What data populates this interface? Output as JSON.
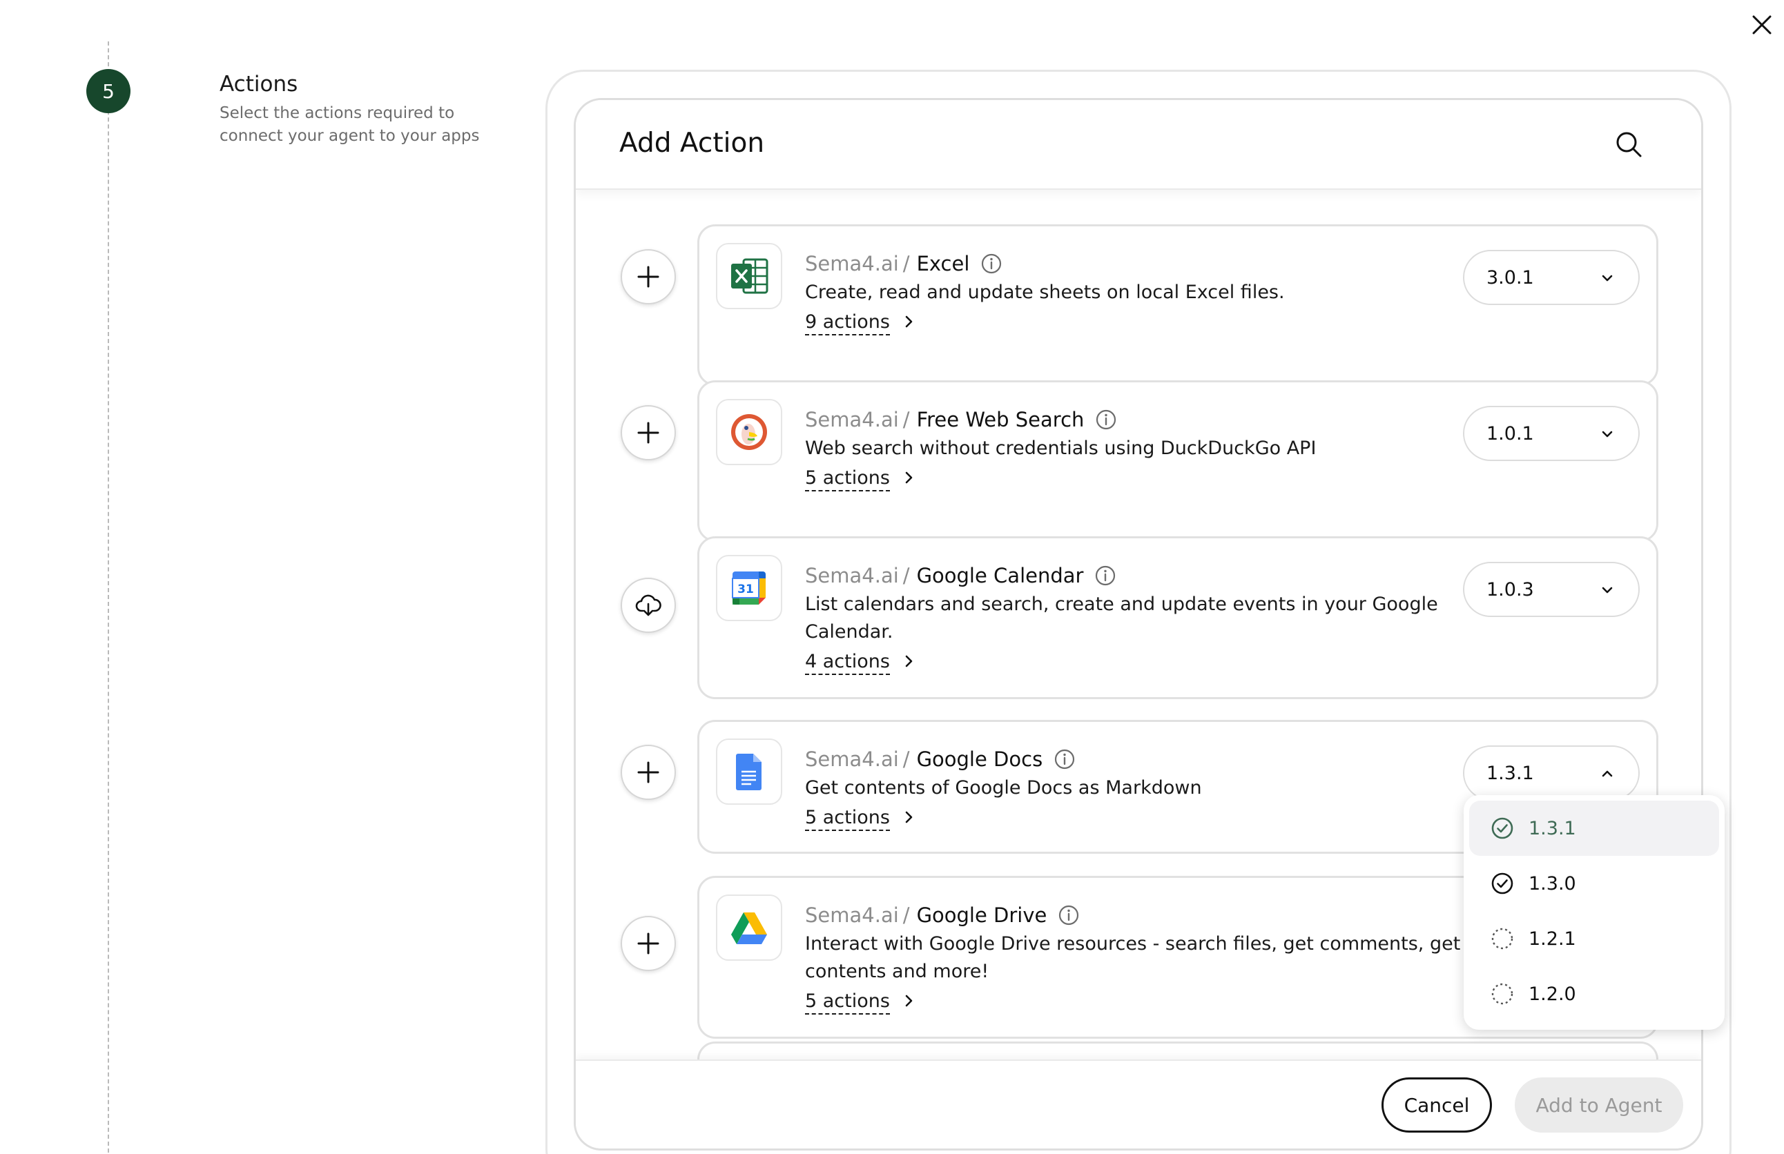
{
  "step": {
    "number": "5",
    "title": "Actions",
    "subtitle": "Select the actions required to connect your agent to your apps"
  },
  "panel": {
    "title": "Add Action"
  },
  "items": [
    {
      "vendor": "Sema4.ai",
      "name": "Excel",
      "description": "Create, read and update sheets on local Excel files.",
      "actions_label": "9 actions",
      "version": "3.0.1",
      "button_state": "add",
      "logo": "excel-logo"
    },
    {
      "vendor": "Sema4.ai",
      "name": "Free Web Search",
      "description": "Web search without credentials using DuckDuckGo API",
      "actions_label": "5 actions",
      "version": "1.0.1",
      "button_state": "add",
      "logo": "duckduckgo-logo"
    },
    {
      "vendor": "Sema4.ai",
      "name": "Google Calendar",
      "description": "List calendars and search, create and update events in your Google Calendar.",
      "actions_label": "4 actions",
      "version": "1.0.3",
      "button_state": "downloading",
      "logo": "google-calendar-logo",
      "logo_text": "31"
    },
    {
      "vendor": "Sema4.ai",
      "name": "Google Docs",
      "description": "Get contents of Google Docs as Markdown",
      "actions_label": "5 actions",
      "version": "1.3.1",
      "button_state": "add",
      "logo": "google-docs-logo",
      "dropdown_open": true
    },
    {
      "vendor": "Sema4.ai",
      "name": "Google Drive",
      "description": "Interact with Google Drive resources - search files, get comments, get contents and more!",
      "actions_label": "5 actions",
      "button_state": "add",
      "logo": "google-drive-logo"
    }
  ],
  "version_dropdown": {
    "options": [
      {
        "label": "1.3.1",
        "status": "installed",
        "selected": true
      },
      {
        "label": "1.3.0",
        "status": "installed",
        "selected": false
      },
      {
        "label": "1.2.1",
        "status": "not-installed",
        "selected": false
      },
      {
        "label": "1.2.0",
        "status": "not-installed",
        "selected": false
      }
    ]
  },
  "footer": {
    "cancel_label": "Cancel",
    "add_label": "Add to Agent"
  },
  "colors": {
    "step_circle": "#17472c",
    "selected_option_text": "#3f6b55"
  }
}
